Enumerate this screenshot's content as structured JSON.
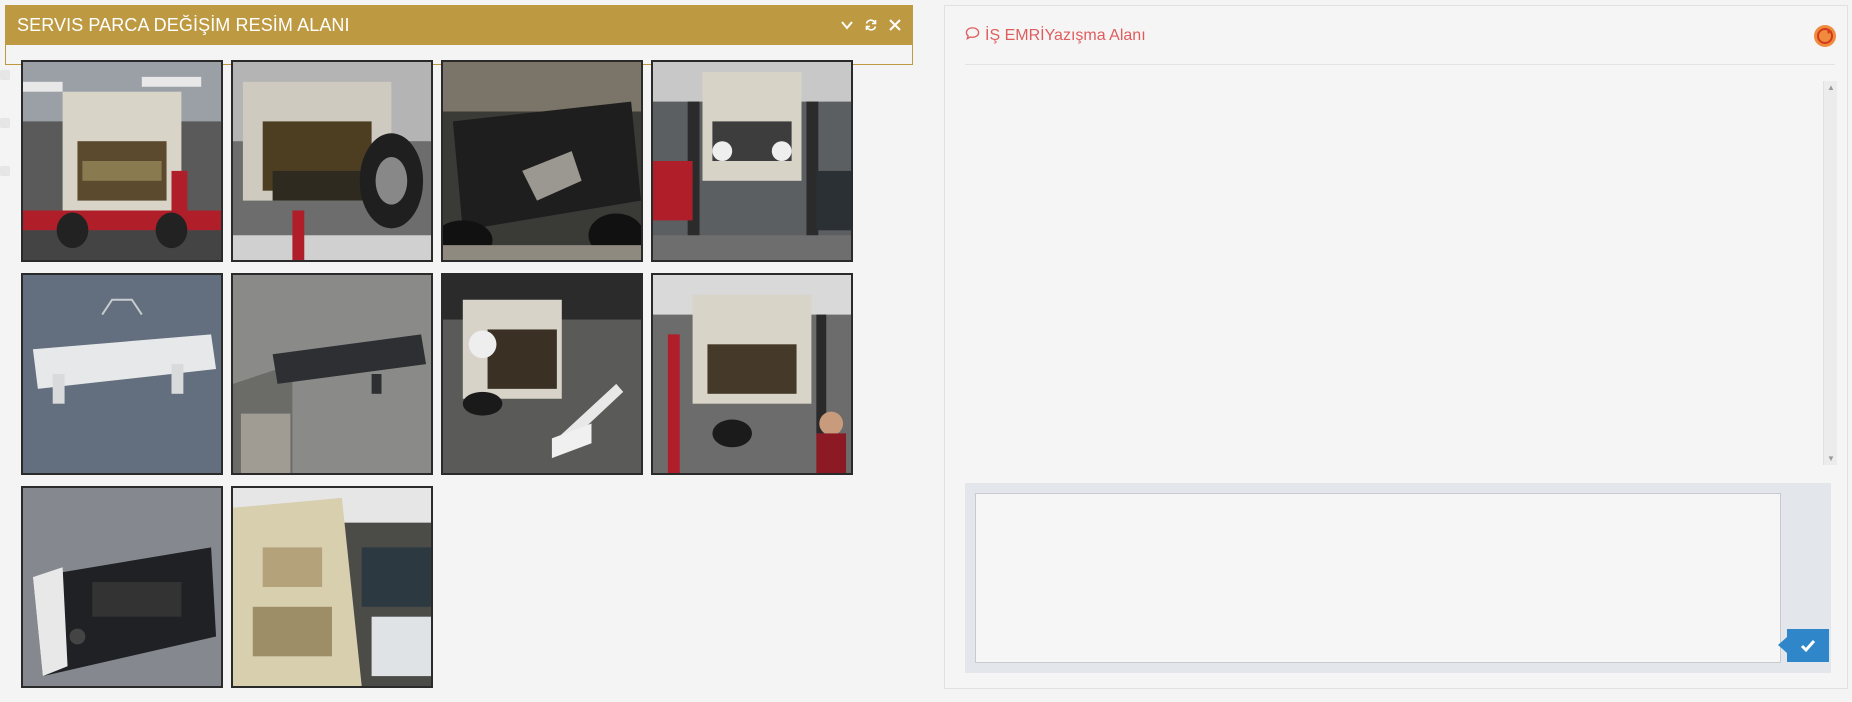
{
  "left_panel": {
    "title": "SERVIS PARCA DEĞİŞİM RESİM ALANI",
    "header_color": "#bd9a42",
    "tools": [
      "chevron-down-icon",
      "refresh-icon",
      "close-icon"
    ],
    "images": [
      {
        "name": "photo-car-front-on-lift"
      },
      {
        "name": "photo-car-underside-lift"
      },
      {
        "name": "photo-underbody-closeup"
      },
      {
        "name": "photo-car-on-lift-workshop"
      },
      {
        "name": "photo-white-bumper-beam"
      },
      {
        "name": "photo-black-bumper-beam"
      },
      {
        "name": "photo-car-front-removed-parts"
      },
      {
        "name": "photo-car-on-lift-mechanic"
      },
      {
        "name": "photo-black-front-bumper"
      },
      {
        "name": "photo-engine-bay-closeup"
      }
    ]
  },
  "right_panel": {
    "title": "İŞ EMRİYazışma Alanı",
    "title_color": "#e05d5d",
    "message_value": "",
    "send_color": "#2f87c9"
  }
}
